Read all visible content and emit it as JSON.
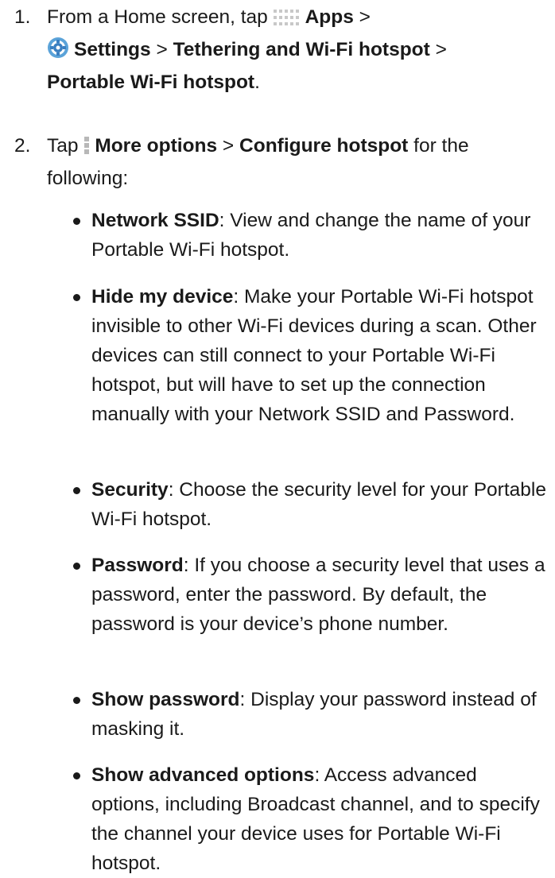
{
  "step1": {
    "number": "1.",
    "prefix": "From a Home screen, tap ",
    "apps_icon": "apps-grid-icon",
    "apps": "Apps",
    "sep1": " >",
    "settings_icon": "settings-gear-icon",
    "settings": "Settings",
    "sep2": " > ",
    "tethering": "Tethering and Wi-Fi hotspot",
    "sep3": " >",
    "portable": "Portable Wi-Fi hotspot",
    "end": "."
  },
  "step2": {
    "number": "2.",
    "prefix": "Tap ",
    "more_icon": "more-options-icon",
    "more": "More options",
    "sep": " > ",
    "configure": "Configure hotspot",
    "suffix": " for the following:"
  },
  "bullets": [
    {
      "term": "Network SSID",
      "desc": ": View and change the name of your Portable Wi-Fi hotspot."
    },
    {
      "term": "Hide my device",
      "desc": ": Make your Portable Wi-Fi hotspot invisible to other Wi-Fi devices during a scan. Other devices can still connect to your Portable Wi-Fi hotspot, but will have to set up the connection manually with your Network SSID and Password."
    },
    {
      "term": "Security",
      "desc": ": Choose the security level for your Portable Wi-Fi hotspot."
    },
    {
      "term": "Password",
      "desc": ": If you choose a security level that uses a password, enter the password. By default, the password is your device’s phone number."
    },
    {
      "term": "Show password",
      "desc": ": Display your password instead of masking it."
    },
    {
      "term": "Show advanced options",
      "desc": ": Access advanced options, including Broadcast channel, and to specify the channel your device uses for Portable Wi-Fi hotspot."
    }
  ]
}
